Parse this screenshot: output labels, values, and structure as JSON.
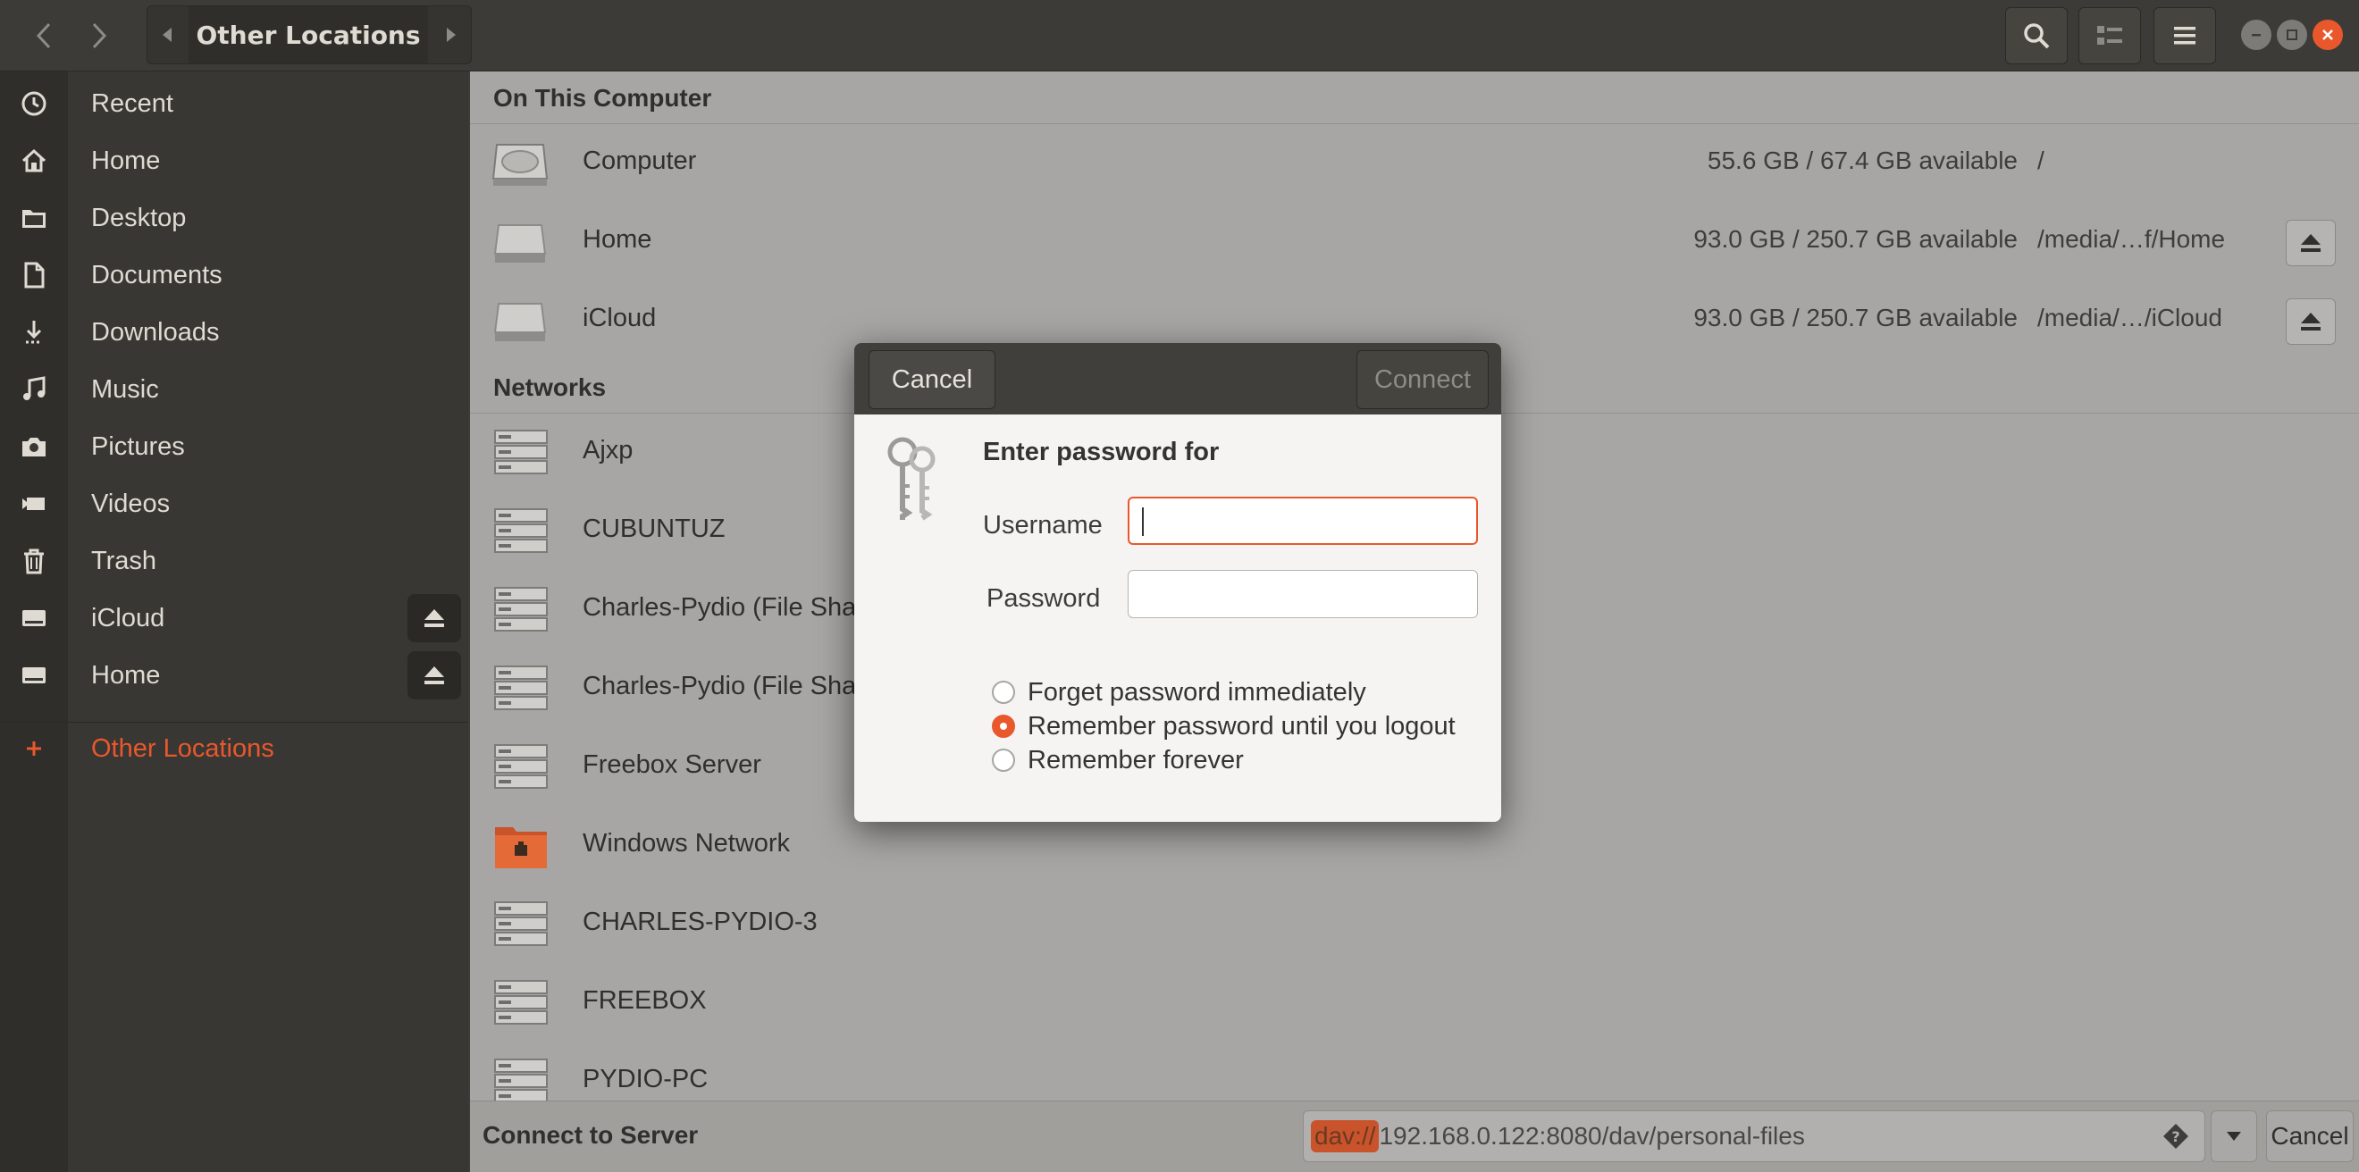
{
  "header": {
    "path_crumb": "Other Locations"
  },
  "sidebar": {
    "items": [
      {
        "label": "Recent",
        "icon": "clock-icon"
      },
      {
        "label": "Home",
        "icon": "home-icon"
      },
      {
        "label": "Desktop",
        "icon": "folder-icon"
      },
      {
        "label": "Documents",
        "icon": "document-icon"
      },
      {
        "label": "Downloads",
        "icon": "download-icon"
      },
      {
        "label": "Music",
        "icon": "music-icon"
      },
      {
        "label": "Pictures",
        "icon": "camera-icon"
      },
      {
        "label": "Videos",
        "icon": "video-icon"
      },
      {
        "label": "Trash",
        "icon": "trash-icon"
      },
      {
        "label": "iCloud",
        "icon": "drive-icon",
        "eject": true
      },
      {
        "label": "Home",
        "icon": "drive-icon",
        "eject": true
      }
    ],
    "other_locations": "Other Locations",
    "accent_color": "#e9582c"
  },
  "main": {
    "on_this_computer": {
      "title": "On This Computer",
      "rows": [
        {
          "name": "Computer",
          "usage": "55.6 GB / 67.4 GB available",
          "path": "/"
        },
        {
          "name": "Home",
          "usage": "93.0 GB / 250.7 GB available",
          "path": "/media/…f/Home"
        },
        {
          "name": "iCloud",
          "usage": "93.0 GB / 250.7 GB available",
          "path": "/media/…/iCloud"
        }
      ]
    },
    "networks": {
      "title": "Networks",
      "rows": [
        {
          "name": "Ajxp"
        },
        {
          "name": "CUBUNTUZ"
        },
        {
          "name": "Charles-Pydio (File Sha"
        },
        {
          "name": "Charles-Pydio (File Sha"
        },
        {
          "name": "Freebox Server"
        },
        {
          "name": "Windows Network"
        },
        {
          "name": "CHARLES-PYDIO-3"
        },
        {
          "name": "FREEBOX"
        },
        {
          "name": "PYDIO-PC"
        }
      ]
    }
  },
  "bottom": {
    "label": "Connect to Server",
    "server_scheme": "dav://",
    "server_rest": "192.168.0.122:8080/dav/personal-files",
    "cancel": "Cancel"
  },
  "dialog": {
    "cancel": "Cancel",
    "connect": "Connect",
    "title": "Enter password for",
    "username_label": "Username",
    "password_label": "Password",
    "username_value": "",
    "password_value": "",
    "options": [
      {
        "label": "Forget password immediately",
        "checked": false
      },
      {
        "label": "Remember password until you logout",
        "checked": true
      },
      {
        "label": "Remember forever",
        "checked": false
      }
    ]
  }
}
